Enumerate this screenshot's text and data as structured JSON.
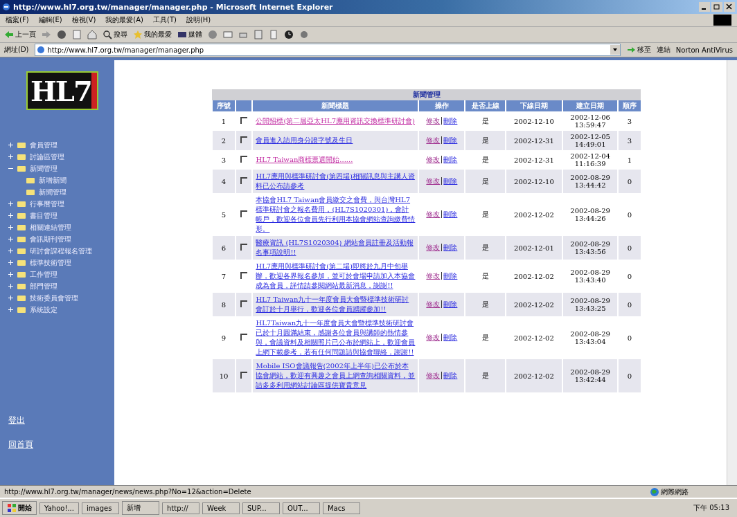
{
  "window": {
    "title": "http://www.hl7.org.tw/manager/manager.php - Microsoft Internet Explorer"
  },
  "menu": [
    "檔案(F)",
    "編輯(E)",
    "檢視(V)",
    "我的最愛(A)",
    "工具(T)",
    "說明(H)"
  ],
  "toolbar": {
    "back": "上一頁",
    "search": "搜尋",
    "favorites": "我的最愛",
    "media": "媒體"
  },
  "address_bar": {
    "label": "網址(D)",
    "value": "http://www.hl7.org.tw/manager/manager.php",
    "go": "移至",
    "links": "連結",
    "norton": "Norton AntiVirus"
  },
  "sidebar": {
    "logo": "HL7",
    "items": [
      {
        "label": "會員管理",
        "expanded": false
      },
      {
        "label": "討論區管理",
        "expanded": false
      },
      {
        "label": "新聞管理",
        "expanded": true,
        "children": [
          {
            "label": "新增新聞"
          },
          {
            "label": "新聞管理"
          }
        ]
      },
      {
        "label": "行事曆管理",
        "expanded": false
      },
      {
        "label": "書目管理",
        "expanded": false
      },
      {
        "label": "相關連結管理",
        "expanded": false
      },
      {
        "label": "會訊期刊管理",
        "expanded": false
      },
      {
        "label": "研討會課程報名管理",
        "expanded": false
      },
      {
        "label": "標準技術管理",
        "expanded": false
      },
      {
        "label": "工作管理",
        "expanded": false
      },
      {
        "label": "部門管理",
        "expanded": false
      },
      {
        "label": "技術委員會管理",
        "expanded": false
      },
      {
        "label": "系統設定",
        "expanded": false
      }
    ],
    "links": [
      "登出",
      "回首頁"
    ]
  },
  "table": {
    "title": "新聞管理",
    "columns": [
      "序號",
      "新聞標題",
      "操作",
      "是否上線",
      "下線日期",
      "建立日期",
      "順序"
    ],
    "rows": [
      {
        "no": "1",
        "checked": false,
        "title": "公開招標(第二屆亞太HL7應用資訊交換標準研討會)",
        "visited": true,
        "edit": "修改",
        "delete": "刪除",
        "online": "是",
        "offline_date": "2002-12-10",
        "created": "2002-12-06 13:59:47",
        "order": "3"
      },
      {
        "no": "2",
        "checked": false,
        "title": "會員進入請用身分證字號及生日",
        "visited": false,
        "edit": "修改",
        "delete": "刪除",
        "online": "是",
        "offline_date": "2002-12-31",
        "created": "2002-12-05 14:49:01",
        "order": "3"
      },
      {
        "no": "3",
        "checked": false,
        "title": "HL7 Taiwan商標票選開始......",
        "visited": true,
        "edit": "修改",
        "delete": "刪除",
        "online": "是",
        "offline_date": "2002-12-31",
        "created": "2002-12-04 11:16:39",
        "order": "1"
      },
      {
        "no": "4",
        "checked": false,
        "title": "HL7應用與標準研討會(第四場)相關訊息與主講人資料已公布請參考",
        "visited": false,
        "edit": "修改",
        "delete": "刪除",
        "online": "是",
        "offline_date": "2002-12-10",
        "created": "2002-08-29 13:44:42",
        "order": "0"
      },
      {
        "no": "5",
        "checked": false,
        "title": "本協會HL7 Taiwan會員繳交之會費，與台灣HL7標準研討會之報名費用，(HL7S1020301)，會計帳戶，歡迎各位會員先行利用本協會網站查詢繳費情形。",
        "visited": false,
        "edit": "修改",
        "delete": "刪除",
        "online": "是",
        "offline_date": "2002-12-02",
        "created": "2002-08-29 13:44:26",
        "order": "0"
      },
      {
        "no": "6",
        "checked": false,
        "title": "醫療資訊 (HL7S1020304) 網站會員註冊及活動報名事項說明!!",
        "visited": false,
        "edit": "修改",
        "delete": "刪除",
        "online": "是",
        "offline_date": "2002-12-01",
        "created": "2002-08-29 13:43:56",
        "order": "0"
      },
      {
        "no": "7",
        "checked": false,
        "title": "HL7應用與標準研討會(第二場)即將於九月中旬舉辦，歡迎各界報名參加，並可於會場申請加入本協會成為會員，詳情請參閱網站最新消息，謝謝!!",
        "visited": false,
        "edit": "修改",
        "delete": "刪除",
        "online": "是",
        "offline_date": "2002-12-02",
        "created": "2002-08-29 13:43:40",
        "order": "0"
      },
      {
        "no": "8",
        "checked": false,
        "title": "HL7 Taiwan九十一年度會員大會暨標準技術研討會訂於十月舉行，歡迎各位會員踴躍參加!!",
        "visited": false,
        "edit": "修改",
        "delete": "刪除",
        "online": "是",
        "offline_date": "2002-12-02",
        "created": "2002-08-29 13:43:25",
        "order": "0"
      },
      {
        "no": "9",
        "checked": false,
        "title": "HL7Taiwan九十一年度會員大會暨標準技術研討會已於十月圓滿結束，感謝各位會員與講師的熱情參與，會議資料及相關照片已公布於網站上，歡迎會員上網下載參考，若有任何問題請與協會聯絡，謝謝!!",
        "visited": false,
        "edit": "修改",
        "delete": "刪除",
        "online": "是",
        "offline_date": "2002-12-02",
        "created": "2002-08-29 13:43:04",
        "order": "0"
      },
      {
        "no": "10",
        "checked": false,
        "title": "Mobile ISO會議報告(2002年上半年)已公布於本協會網站，歡迎有興趣之會員上網查詢相關資料，並請多多利用網站討論區提供寶貴意見",
        "visited": false,
        "edit": "修改",
        "delete": "刪除",
        "online": "是",
        "offline_date": "2002-12-02",
        "created": "2002-08-29 13:42:44",
        "order": "0"
      }
    ]
  },
  "status_bar": {
    "url": "http://www.hl7.org.tw/manager/news/news.php?No=12&action=Delete",
    "zone": "網際網路"
  },
  "taskbar": {
    "start": "開始",
    "tasks": [
      "Yahoo!...",
      "images",
      "新增",
      "http://",
      "Week",
      "SUP...",
      "OUT...",
      "Macs"
    ],
    "clock": "下午 05:13"
  }
}
